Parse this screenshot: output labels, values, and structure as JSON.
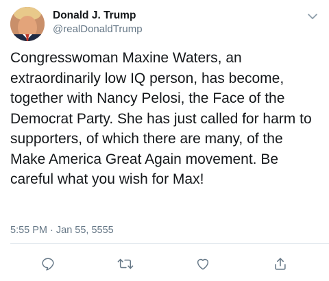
{
  "author": {
    "display_name": "Donald J. Trump",
    "handle": "@realDonaldTrump"
  },
  "tweet": {
    "text": "Congresswoman Maxine Waters, an extraordinarily low IQ person, has become, together with Nancy Pelosi, the Face of the Democrat Party. She has just called for harm to supporters, of which there are many, of the Make America Great Again movement. Be careful what you wish for Max!",
    "timestamp": "5:55 PM · Jan 55, 5555"
  },
  "icons": {
    "menu": "chevron-down-icon",
    "reply": "reply-icon",
    "retweet": "retweet-icon",
    "like": "heart-icon",
    "share": "share-icon"
  },
  "colors": {
    "text": "#14171a",
    "secondary": "#657786",
    "icon": "#657786",
    "divider": "#e1e8ed"
  }
}
